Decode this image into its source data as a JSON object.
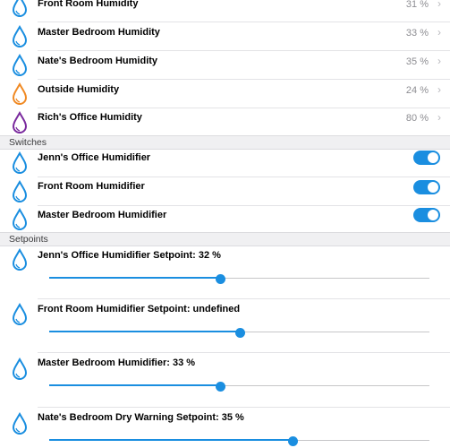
{
  "colors": {
    "accent": "#1a8ee0",
    "orange": "#f08a24",
    "purple": "#7a2a9e"
  },
  "humidity": [
    {
      "label": "Front Room Humidity",
      "value": "31 %",
      "icon": "water-drop-icon",
      "color": "#1a8ee0"
    },
    {
      "label": "Master Bedroom Humidity",
      "value": "33 %",
      "icon": "water-drop-icon",
      "color": "#1a8ee0"
    },
    {
      "label": "Nate's Bedroom Humidity",
      "value": "35 %",
      "icon": "water-drop-icon",
      "color": "#1a8ee0"
    },
    {
      "label": "Outside Humidity",
      "value": "24 %",
      "icon": "water-drop-icon",
      "color": "#f08a24"
    },
    {
      "label": "Rich's Office Humidity",
      "value": "80 %",
      "icon": "water-drop-icon",
      "color": "#7a2a9e"
    }
  ],
  "switches": {
    "header": "Switches",
    "items": [
      {
        "label": "Jenn's Office Humidifier",
        "on": true
      },
      {
        "label": "Front Room Humidifier",
        "on": true
      },
      {
        "label": "Master Bedroom Humidifier",
        "on": true
      }
    ]
  },
  "setpoints": {
    "header": "Setpoints",
    "items": [
      {
        "label": "Jenn's Office Humidifier Setpoint: 32 %",
        "level": 0.45
      },
      {
        "label": "Front Room Humidifier Setpoint: undefined",
        "level": 0.5
      },
      {
        "label": "Master Bedroom Humidifier: 33 %",
        "level": 0.45
      },
      {
        "label": "Nate's Bedroom Dry Warning Setpoint: 35 %",
        "level": 0.64
      }
    ]
  }
}
